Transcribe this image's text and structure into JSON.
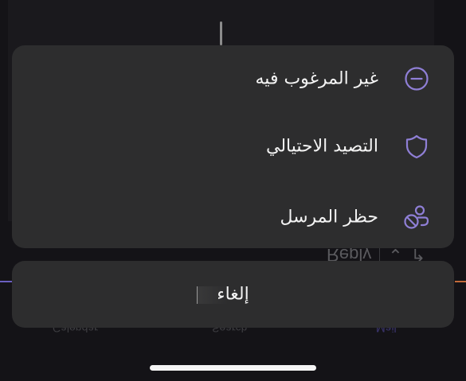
{
  "background": {
    "reply_label": "Reply",
    "tabs": [
      "Mail",
      "Search",
      "Calendar"
    ]
  },
  "action_sheet": {
    "items": [
      {
        "label": "غير المرغوب فيه",
        "icon": "minus-circle-icon"
      },
      {
        "label": "التصيد الاحتيالي",
        "icon": "shield-icon"
      },
      {
        "label": "حظر المرسل",
        "icon": "block-sender-icon"
      }
    ],
    "cancel_label": "إلغاء"
  },
  "colors": {
    "accent": "#8f7fd6",
    "sheet_background": "#2d2d2e",
    "page_background": "#151417"
  }
}
